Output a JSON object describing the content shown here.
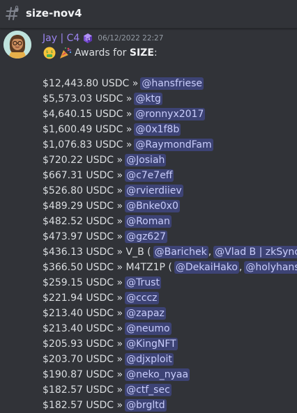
{
  "header": {
    "channel_icon": "hash-channel-icon",
    "channel_name": "size-nov4"
  },
  "message": {
    "author": "Jay | C4",
    "role_icon": "purple-cube-icon",
    "timestamp": "06/12/2022 22:27",
    "award_emojis": [
      "money-mouth-face-emoji",
      "party-popper-emoji"
    ],
    "award_prefix": "Awards for ",
    "award_bold": "SIZE",
    "award_suffix": ":",
    "rows": [
      {
        "amount": "$12,443.80 USDC »",
        "mention": "@hansfriese"
      },
      {
        "amount": "$5,573.03 USDC »",
        "mention": "@ktg"
      },
      {
        "amount": "$4,640.15 USDC »",
        "mention": "@ronnyx2017"
      },
      {
        "amount": "$1,600.49 USDC »",
        "mention": "@0x1f8b"
      },
      {
        "amount": "$1,076.83 USDC »",
        "mention": "@RaymondFam"
      },
      {
        "amount": "$720.22 USDC »",
        "mention": "@Josiah"
      },
      {
        "amount": "$667.31 USDC »",
        "mention": "@c7e7eff"
      },
      {
        "amount": "$526.80 USDC »",
        "mention": "@rvierdiiev"
      },
      {
        "amount": "$489.29 USDC »",
        "mention": "@Bnke0x0"
      },
      {
        "amount": "$482.52 USDC »",
        "mention": "@Roman"
      },
      {
        "amount": "$473.97 USDC »",
        "mention": "@gz627"
      },
      {
        "amount": "$436.13 USDC » V_B (",
        "mention": "@Barichek",
        "sep": ",",
        "mention2": "@Vlad B | zkSync",
        "tail": ")"
      },
      {
        "amount": "$366.50 USDC » M4TZ1P (",
        "mention": "@DekaiHako",
        "sep": ",",
        "mention2": "@holyhansss",
        "tail": ""
      },
      {
        "amount": "$259.15 USDC »",
        "mention": "@Trust"
      },
      {
        "amount": "$221.94 USDC »",
        "mention": "@cccz"
      },
      {
        "amount": "$213.40 USDC »",
        "mention": "@zapaz"
      },
      {
        "amount": "$213.40 USDC »",
        "mention": "@neumo"
      },
      {
        "amount": "$205.93 USDC »",
        "mention": "@KingNFT"
      },
      {
        "amount": "$203.70 USDC »",
        "mention": "@djxploit"
      },
      {
        "amount": "$190.87 USDC »",
        "mention": "@neko_nyaa"
      },
      {
        "amount": "$182.57 USDC »",
        "mention": "@ctf_sec"
      },
      {
        "amount": "$182.57 USDC »",
        "mention": "@brgltd"
      }
    ]
  },
  "colors": {
    "background": "#313338",
    "author": "#9b84ee",
    "text": "#dbdee1",
    "mention_bg": "#5865f2",
    "mention_text": "#c9cdfb",
    "timestamp": "#949ba4"
  }
}
